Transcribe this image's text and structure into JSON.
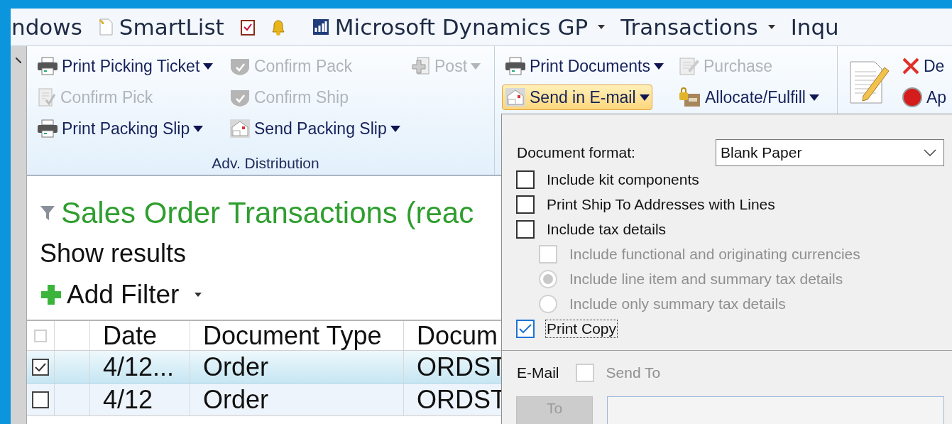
{
  "menu_bar": {
    "items": [
      {
        "label": "ndows",
        "dropdown": false
      },
      {
        "label": "SmartList",
        "dropdown": false
      },
      {
        "label": "Microsoft Dynamics GP",
        "dropdown": true
      },
      {
        "label": "Transactions",
        "dropdown": true
      },
      {
        "label": "Inqu",
        "dropdown": false
      }
    ]
  },
  "ribbon": {
    "groups": [
      {
        "label": "Adv. Distribution",
        "columns": [
          [
            {
              "label": "Print Picking Ticket",
              "disabled": false,
              "dropdown": true,
              "highlighted": false
            },
            {
              "label": "Confirm Pick",
              "disabled": true,
              "dropdown": false,
              "highlighted": false
            },
            {
              "label": "Print Packing Slip",
              "disabled": false,
              "dropdown": true,
              "highlighted": false
            }
          ],
          [
            {
              "label": "Confirm Pack",
              "disabled": true,
              "dropdown": false,
              "highlighted": false
            },
            {
              "label": "Confirm Ship",
              "disabled": true,
              "dropdown": false,
              "highlighted": false
            },
            {
              "label": "Send Packing Slip",
              "disabled": false,
              "dropdown": true,
              "highlighted": false
            }
          ],
          [
            {
              "label": "Post",
              "disabled": true,
              "dropdown": true,
              "highlighted": false
            }
          ]
        ]
      },
      {
        "columns": [
          [
            {
              "label": "Print Documents",
              "disabled": false,
              "dropdown": true,
              "highlighted": false
            },
            {
              "label": "Send in E-mail",
              "disabled": false,
              "dropdown": true,
              "highlighted": true
            }
          ],
          [
            {
              "label": "Purchase",
              "disabled": true,
              "dropdown": false,
              "highlighted": false
            },
            {
              "label": "Allocate/Fulfill",
              "disabled": false,
              "dropdown": true,
              "highlighted": false
            }
          ]
        ]
      },
      {
        "columns": [
          [
            {
              "label": "De",
              "disabled": false,
              "dropdown": false,
              "highlighted": false
            },
            {
              "label": "Ap",
              "disabled": false,
              "dropdown": false,
              "highlighted": false
            }
          ]
        ]
      }
    ]
  },
  "content": {
    "title": "Sales Order Transactions (reac",
    "show_results": "Show results",
    "add_filter": "Add Filter",
    "table": {
      "header_checked": false,
      "columns": [
        "Date",
        "Document Type",
        "Docum"
      ],
      "rows": [
        {
          "checked": true,
          "selected": true,
          "cells": [
            "4/12...",
            "Order",
            "ORDST"
          ]
        },
        {
          "checked": false,
          "selected": false,
          "cells": [
            "4/12",
            "Order",
            "ORDST"
          ]
        }
      ]
    }
  },
  "email_panel": {
    "document_format": {
      "label": "Document format:",
      "value": "Blank Paper"
    },
    "options": [
      {
        "kind": "checkbox",
        "label": "Include kit components",
        "checked": false,
        "disabled": false,
        "focused": false
      },
      {
        "kind": "checkbox",
        "label": "Print Ship To Addresses with Lines",
        "checked": false,
        "disabled": false,
        "focused": false
      },
      {
        "kind": "checkbox",
        "label": "Include tax details",
        "checked": false,
        "disabled": false,
        "focused": false,
        "children": [
          {
            "kind": "checkbox",
            "label": "Include functional and originating currencies",
            "checked": false,
            "disabled": true,
            "focused": false
          },
          {
            "kind": "radio",
            "label": "Include line item and summary tax details",
            "checked": true,
            "disabled": true,
            "focused": false
          },
          {
            "kind": "radio",
            "label": "Include only summary tax details",
            "checked": false,
            "disabled": true,
            "focused": false
          }
        ]
      },
      {
        "kind": "checkbox",
        "label": "Print Copy",
        "checked": true,
        "disabled": false,
        "focused": true
      }
    ],
    "email": {
      "label": "E-Mail",
      "send_to": {
        "label": "Send To",
        "checked": false,
        "disabled": true
      },
      "to_button": {
        "label": "To",
        "disabled": true
      }
    }
  }
}
